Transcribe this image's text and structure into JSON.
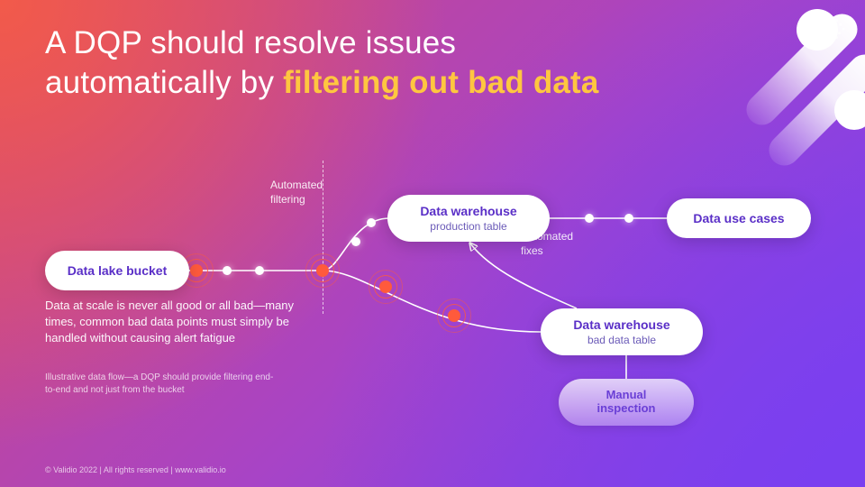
{
  "title": {
    "line1": "A DQP should resolve issues",
    "line2_prefix": "automatically by ",
    "line2_highlight": "filtering out bad data"
  },
  "captions": {
    "automated_filtering": "Automated\nfiltering",
    "automated_fixes": "Automated\nfixes"
  },
  "nodes": {
    "data_lake": {
      "title": "Data lake bucket"
    },
    "dw_prod": {
      "title": "Data warehouse",
      "subtitle": "production table"
    },
    "dw_bad": {
      "title": "Data warehouse",
      "subtitle": "bad data table"
    },
    "use_cases": {
      "title": "Data use cases"
    },
    "manual": {
      "title": "Manual\ninspection"
    }
  },
  "body_text": "Data at scale is never all good or all bad—many times, common bad data points must simply be handled without causing alert fatigue",
  "footnote": "Illustrative data flow—a DQP should provide filtering end-to-end and not just from the bucket",
  "copyright": "© Validio 2022 | All rights reserved | www.validio.io"
}
